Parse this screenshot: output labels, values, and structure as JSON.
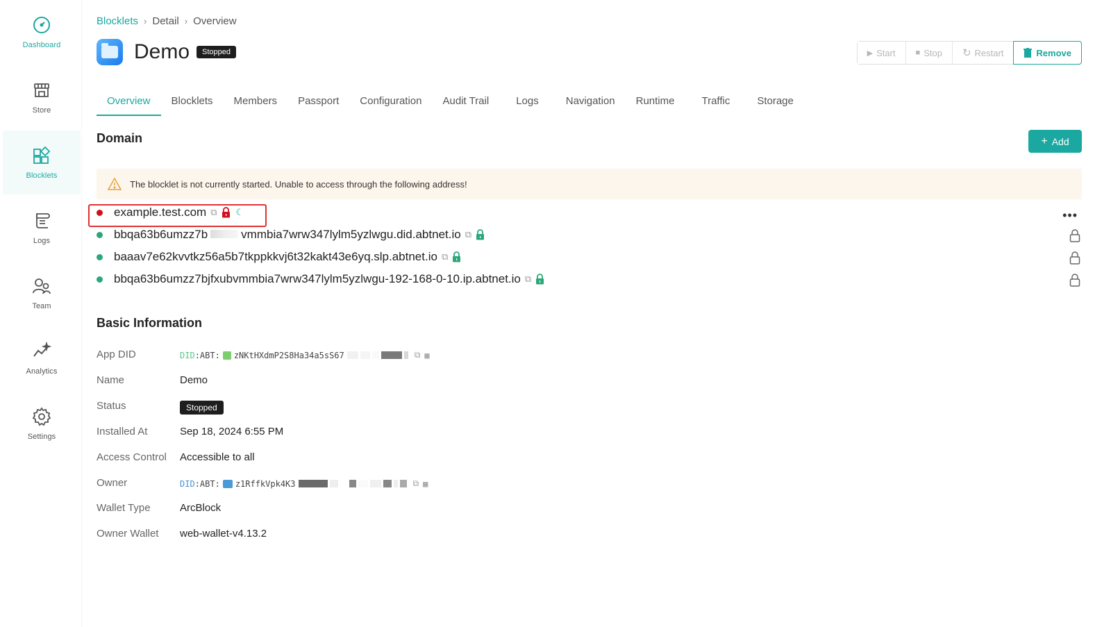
{
  "sidebar": {
    "items": [
      {
        "label": "Dashboard",
        "icon": "dashboard-icon"
      },
      {
        "label": "Store",
        "icon": "store-icon"
      },
      {
        "label": "Blocklets",
        "icon": "blocklets-icon"
      },
      {
        "label": "Logs",
        "icon": "logs-icon"
      },
      {
        "label": "Team",
        "icon": "team-icon"
      },
      {
        "label": "Analytics",
        "icon": "analytics-icon"
      },
      {
        "label": "Settings",
        "icon": "settings-icon"
      }
    ],
    "active": "Blocklets"
  },
  "breadcrumb": [
    "Blocklets",
    "Detail",
    "Overview"
  ],
  "header": {
    "title": "Demo",
    "status_badge": "Stopped"
  },
  "actions": {
    "start": "Start",
    "stop": "Stop",
    "restart": "Restart",
    "remove": "Remove"
  },
  "tabs": [
    "Overview",
    "Blocklets",
    "Members",
    "Passport",
    "Configuration",
    "Audit Trail",
    "Logs",
    "Navigation",
    "Runtime",
    "Traffic",
    "Storage"
  ],
  "active_tab": "Overview",
  "domain": {
    "title": "Domain",
    "add_label": "Add",
    "warning": "The blocklet is not currently started. Unable to access through the following address!",
    "entries": [
      {
        "host": "example.test.com",
        "status": "red"
      },
      {
        "host_start": "bbqa63b6umzz7b",
        "host_end": "vmmbia7wrw347lylm5yzlwgu.did.abtnet.io",
        "status": "green"
      },
      {
        "host": "baaav7e62kvvtkz56a5b7tkppkkvj6t32kakt43e6yq.slp.abtnet.io",
        "status": "green"
      },
      {
        "host": "bbqa63b6umzz7bjfxubvmmbia7wrw347lylm5yzlwgu-192-168-0-10.ip.abtnet.io",
        "status": "green"
      }
    ]
  },
  "basic_info": {
    "title": "Basic Information",
    "labels": {
      "app_did": "App DID",
      "name": "Name",
      "status": "Status",
      "installed_at": "Installed At",
      "access_control": "Access Control",
      "owner": "Owner",
      "wallet_type": "Wallet Type",
      "owner_wallet": "Owner Wallet"
    },
    "values": {
      "app_did_prefix": "DID",
      "app_did_body": ":ABT:",
      "app_did_partial": "zNKtHXdmP2S8Ha34a5sS67",
      "name": "Demo",
      "status": "Stopped",
      "installed_at": "Sep 18, 2024 6:55 PM",
      "access_control": "Accessible to all",
      "owner_prefix": "DID",
      "owner_body": ":ABT:",
      "owner_partial": "z1RffkVpk4K3",
      "wallet_type": "ArcBlock",
      "owner_wallet": "web-wallet-v4.13.2"
    }
  },
  "colors": {
    "accent": "#1aa8a0",
    "danger": "#d0101f",
    "success": "#2aa87a",
    "warning_bg": "#fdf6ec"
  }
}
